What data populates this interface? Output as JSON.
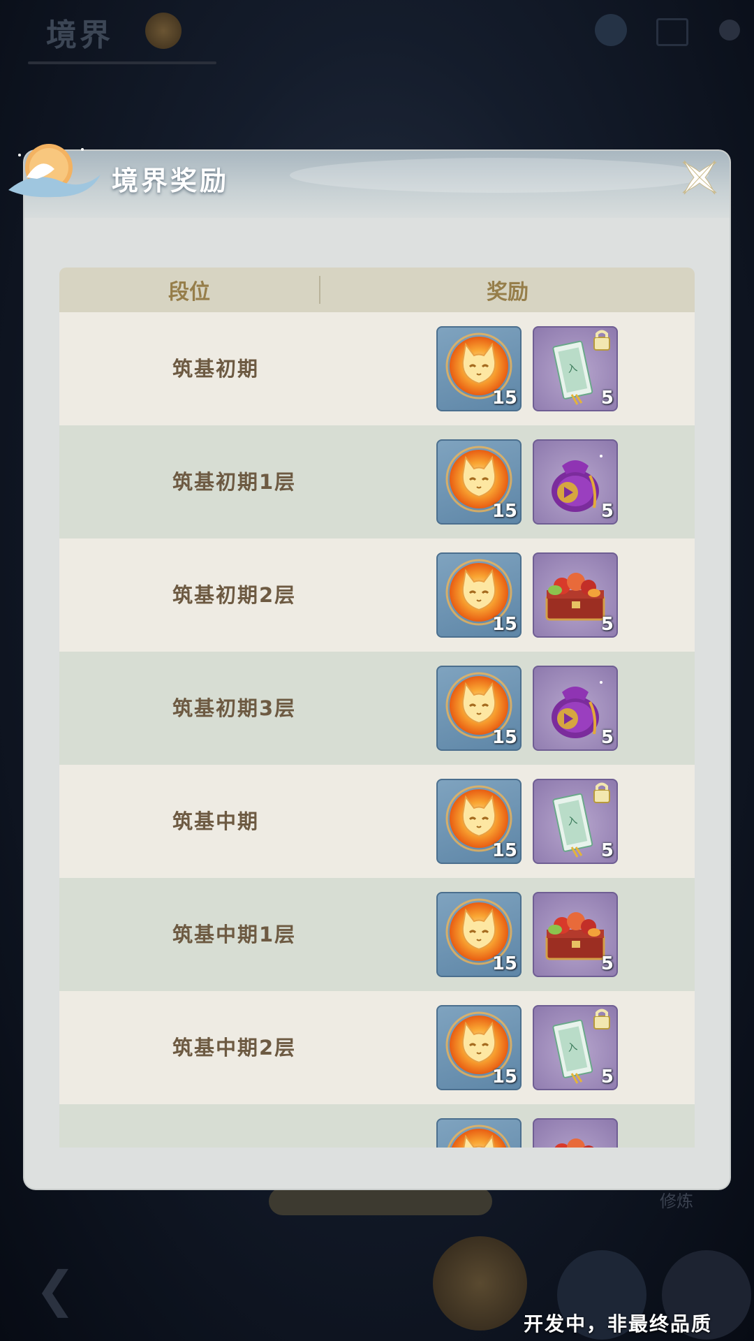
{
  "background": {
    "title": "境界",
    "tag": "修炼"
  },
  "dialog": {
    "title": "境界奖励",
    "close_icon": "close-x-icon"
  },
  "table": {
    "headers": {
      "tier": "段位",
      "reward": "奖励"
    },
    "rows": [
      {
        "tier": "筑基初期",
        "reward1": {
          "icon": "fox-spirit-icon",
          "count": "15"
        },
        "reward2": {
          "icon": "locked-ticket-icon",
          "count": "5"
        }
      },
      {
        "tier": "筑基初期1层",
        "reward1": {
          "icon": "fox-spirit-icon",
          "count": "15"
        },
        "reward2": {
          "icon": "purple-pouch-icon",
          "count": "5"
        }
      },
      {
        "tier": "筑基初期2层",
        "reward1": {
          "icon": "fox-spirit-icon",
          "count": "15"
        },
        "reward2": {
          "icon": "food-chest-icon",
          "count": "5"
        }
      },
      {
        "tier": "筑基初期3层",
        "reward1": {
          "icon": "fox-spirit-icon",
          "count": "15"
        },
        "reward2": {
          "icon": "purple-pouch-icon",
          "count": "5"
        }
      },
      {
        "tier": "筑基中期",
        "reward1": {
          "icon": "fox-spirit-icon",
          "count": "15"
        },
        "reward2": {
          "icon": "locked-ticket-icon",
          "count": "5"
        }
      },
      {
        "tier": "筑基中期1层",
        "reward1": {
          "icon": "fox-spirit-icon",
          "count": "15"
        },
        "reward2": {
          "icon": "food-chest-icon",
          "count": "5"
        }
      },
      {
        "tier": "筑基中期2层",
        "reward1": {
          "icon": "fox-spirit-icon",
          "count": "15"
        },
        "reward2": {
          "icon": "locked-ticket-icon",
          "count": "5"
        }
      },
      {
        "tier": "",
        "reward1": {
          "icon": "fox-spirit-icon",
          "count": ""
        },
        "reward2": {
          "icon": "food-chest-icon",
          "count": ""
        }
      }
    ]
  },
  "watermark": "开发中，非最终品质",
  "colors": {
    "header_gold": "#967e4a",
    "tier_text": "#6d5a42",
    "row_light": "#eeebe3",
    "row_green": "#d7ddd3"
  }
}
